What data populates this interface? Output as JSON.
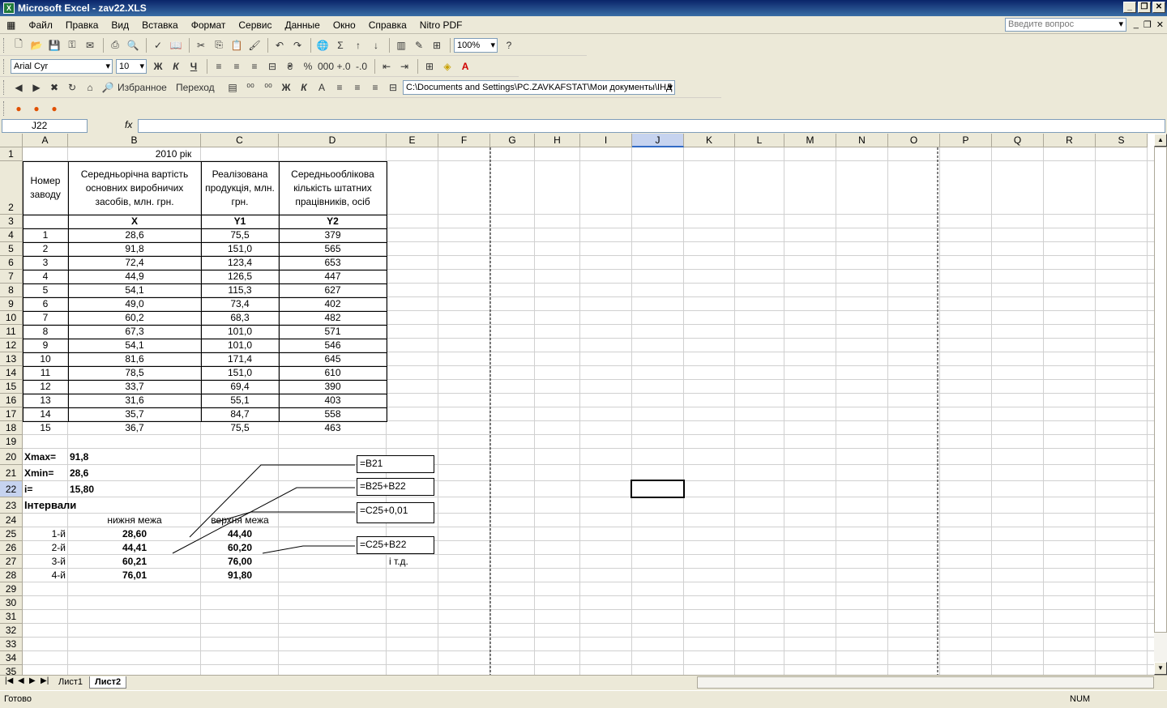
{
  "window": {
    "title": "Microsoft Excel - zav22.XLS"
  },
  "menu": [
    "Файл",
    "Правка",
    "Вид",
    "Вставка",
    "Формат",
    "Сервис",
    "Данные",
    "Окно",
    "Справка",
    "Nitro PDF"
  ],
  "ask": {
    "placeholder": "Введите вопрос"
  },
  "toolbar": {
    "zoom": "100%",
    "font": "Arial Cyr",
    "size": "10",
    "favorites": "Избранное",
    "goto": "Переход",
    "path": "C:\\Documents and Settings\\PC.ZAVKAFSTAT\\Мои документы\\ІНД"
  },
  "namebox": "J22",
  "columns": [
    "A",
    "B",
    "C",
    "D",
    "E",
    "F",
    "G",
    "H",
    "I",
    "J",
    "K",
    "L",
    "M",
    "N",
    "O",
    "P",
    "Q",
    "R",
    "S"
  ],
  "selected_col": "J",
  "selected_row": "22",
  "sheet": {
    "title": "2010 рік",
    "headers": [
      "Номер заводу",
      "Середньорічна вартість основних виробничих засобів, млн. грн.",
      "Реалізована продукція, млн. грн.",
      "Середньооблікова кількість штатних працівників, осіб"
    ],
    "symbols": [
      "X",
      "Y1",
      "Y2"
    ],
    "rows": [
      [
        "1",
        "28,6",
        "75,5",
        "379"
      ],
      [
        "2",
        "91,8",
        "151,0",
        "565"
      ],
      [
        "3",
        "72,4",
        "123,4",
        "653"
      ],
      [
        "4",
        "44,9",
        "126,5",
        "447"
      ],
      [
        "5",
        "54,1",
        "115,3",
        "627"
      ],
      [
        "6",
        "49,0",
        "73,4",
        "402"
      ],
      [
        "7",
        "60,2",
        "68,3",
        "482"
      ],
      [
        "8",
        "67,3",
        "101,0",
        "571"
      ],
      [
        "9",
        "54,1",
        "101,0",
        "546"
      ],
      [
        "10",
        "81,6",
        "171,4",
        "645"
      ],
      [
        "11",
        "78,5",
        "151,0",
        "610"
      ],
      [
        "12",
        "33,7",
        "69,4",
        "390"
      ],
      [
        "13",
        "31,6",
        "55,1",
        "403"
      ],
      [
        "14",
        "35,7",
        "84,7",
        "558"
      ],
      [
        "15",
        "36,7",
        "75,5",
        "463"
      ]
    ],
    "xmax_label": "Xmax=",
    "xmax": "91,8",
    "xmin_label": "Xmin=",
    "xmin": "28,6",
    "i_label": "i=",
    "i": "15,80",
    "intervals_label": "Інтервали",
    "lower_label": "нижня межа",
    "upper_label": "верхня межа",
    "intervals": [
      [
        "1-й",
        "28,60",
        "44,40"
      ],
      [
        "2-й",
        "44,41",
        "60,20"
      ],
      [
        "3-й",
        "60,21",
        "76,00"
      ],
      [
        "4-й",
        "76,01",
        "91,80"
      ]
    ],
    "etc": "і т.д.",
    "callouts": [
      "=B21",
      "=B25+B22",
      "=C25+0,01",
      "=C25+B22"
    ]
  },
  "tabs": [
    "Лист1",
    "Лист2"
  ],
  "active_tab": "Лист2",
  "status": {
    "left": "Готово",
    "num": "NUM"
  }
}
